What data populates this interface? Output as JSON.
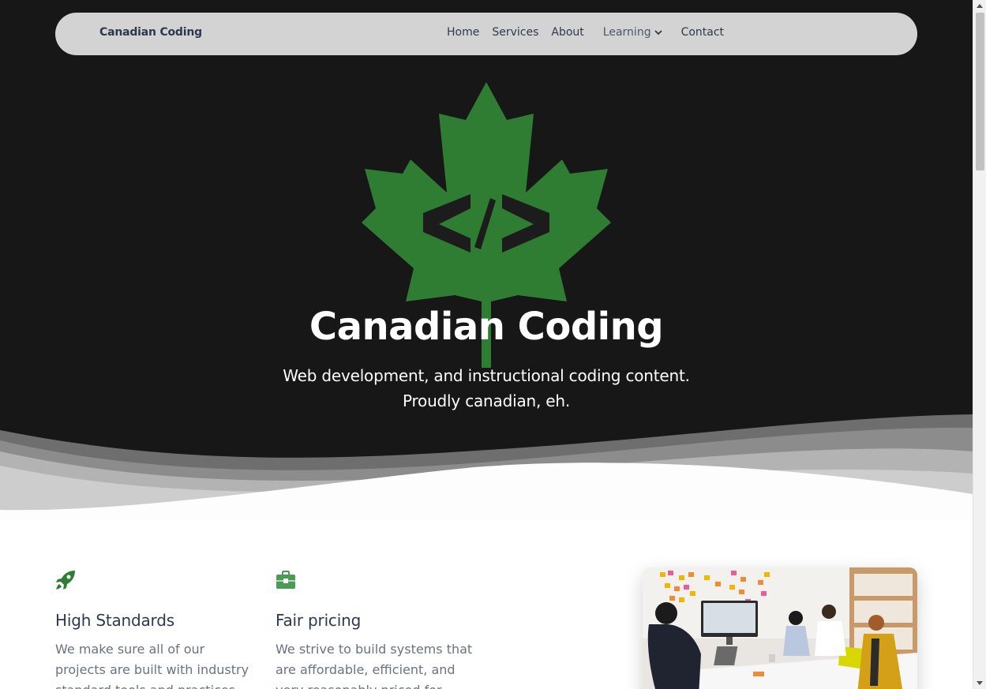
{
  "nav": {
    "brand": "Canadian Coding",
    "links": [
      "Home",
      "Services",
      "About",
      "Learning",
      "Contact"
    ]
  },
  "hero": {
    "title": "Canadian Coding",
    "subtitle_line1": "Web development, and instructional coding content.",
    "subtitle_line2": "Proudly canadian, eh."
  },
  "features": [
    {
      "icon": "rocket-icon",
      "title": "High Standards",
      "text": "We make sure all of our projects are built with industry standard tools and practices for the best"
    },
    {
      "icon": "briefcase-icon",
      "title": "Fair pricing",
      "text": "We strive to build systems that are affordable, efficient, and very reasonably priced for projects of"
    }
  ],
  "colors": {
    "hero_bg": "#171717",
    "leaf_green": "#2e7d32",
    "navbar_bg": "#d3d3d3",
    "text_dark": "#2c3a4d"
  }
}
